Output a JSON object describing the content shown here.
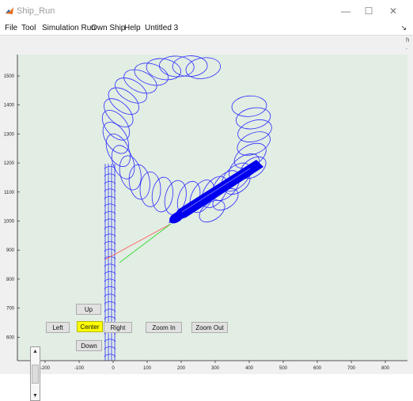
{
  "window": {
    "title": "Ship_Run",
    "controls": [
      "—",
      "☐",
      "✕"
    ]
  },
  "menubar": {
    "items": [
      "File",
      "Tool",
      "Simulation Run",
      "Own Ship",
      "Help",
      "Untitled 3"
    ],
    "arrow": "↘"
  },
  "background_fragments": [
    "h",
    "h",
    "h"
  ],
  "plot": {
    "x_ticks": [
      "-200",
      "-100",
      "0",
      "100",
      "200",
      "300",
      "400",
      "500",
      "600",
      "700",
      "800"
    ],
    "y_ticks": [
      "1500",
      "1400",
      "1300",
      "1200",
      "1100",
      "1000",
      "900",
      "800",
      "700",
      "600"
    ],
    "colors": {
      "background": "#e2ede3",
      "track": "#2b2bff",
      "ship": "#0000ee",
      "line_red": "#ff5a5a",
      "line_green": "#33dd33"
    }
  },
  "controls": {
    "up": "Up",
    "left": "Left",
    "center": "Center",
    "right": "Right",
    "down": "Down",
    "zoom_in": "Zoom In",
    "zoom_out": "Zoom Out"
  }
}
